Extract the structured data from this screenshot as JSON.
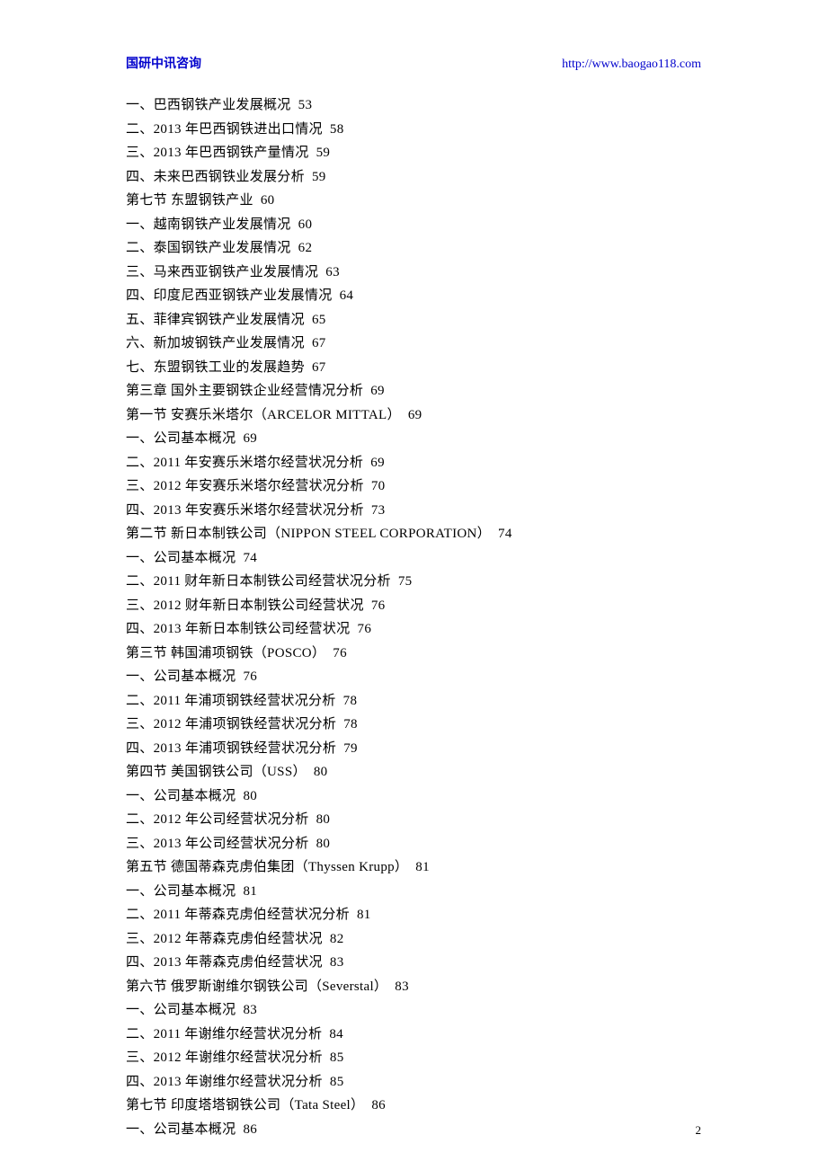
{
  "header": {
    "left": "国研中讯咨询",
    "right": "http://www.baogao118.com"
  },
  "toc": [
    {
      "label": "一、巴西钢铁产业发展概况",
      "page": "53"
    },
    {
      "label": "二、2013 年巴西钢铁进出口情况",
      "page": "58"
    },
    {
      "label": "三、2013 年巴西钢铁产量情况",
      "page": "59"
    },
    {
      "label": "四、未来巴西钢铁业发展分析",
      "page": "59"
    },
    {
      "label": "第七节  东盟钢铁产业",
      "page": "60"
    },
    {
      "label": "一、越南钢铁产业发展情况",
      "page": "60"
    },
    {
      "label": "二、泰国钢铁产业发展情况",
      "page": "62"
    },
    {
      "label": "三、马来西亚钢铁产业发展情况",
      "page": "63"
    },
    {
      "label": "四、印度尼西亚钢铁产业发展情况",
      "page": "64"
    },
    {
      "label": "五、菲律宾钢铁产业发展情况",
      "page": "65"
    },
    {
      "label": "六、新加坡钢铁产业发展情况",
      "page": "67"
    },
    {
      "label": "七、东盟钢铁工业的发展趋势",
      "page": "67"
    },
    {
      "label": "第三章  国外主要钢铁企业经营情况分析",
      "page": "69"
    },
    {
      "label": "第一节  安赛乐米塔尔（ARCELOR MITTAL）",
      "page": "69"
    },
    {
      "label": "一、公司基本概况",
      "page": "69"
    },
    {
      "label": "二、2011 年安赛乐米塔尔经营状况分析",
      "page": "69"
    },
    {
      "label": "三、2012 年安赛乐米塔尔经营状况分析",
      "page": "70"
    },
    {
      "label": "四、2013 年安赛乐米塔尔经营状况分析",
      "page": "73"
    },
    {
      "label": "第二节  新日本制铁公司（NIPPON STEEL CORPORATION）",
      "page": "74"
    },
    {
      "label": "一、公司基本概况",
      "page": "74"
    },
    {
      "label": "二、2011 财年新日本制铁公司经营状况分析",
      "page": "75"
    },
    {
      "label": "三、2012 财年新日本制铁公司经营状况",
      "page": "76"
    },
    {
      "label": "四、2013 年新日本制铁公司经营状况",
      "page": "76"
    },
    {
      "label": "第三节  韩国浦项钢铁（POSCO）",
      "page": "76"
    },
    {
      "label": "一、公司基本概况",
      "page": "76"
    },
    {
      "label": "二、2011 年浦项钢铁经营状况分析",
      "page": "78"
    },
    {
      "label": "三、2012 年浦项钢铁经营状况分析",
      "page": "78"
    },
    {
      "label": "四、2013 年浦项钢铁经营状况分析",
      "page": "79"
    },
    {
      "label": "第四节  美国钢铁公司（USS）",
      "page": "80"
    },
    {
      "label": "一、公司基本概况",
      "page": "80"
    },
    {
      "label": "二、2012 年公司经营状况分析",
      "page": "80"
    },
    {
      "label": "三、2013 年公司经营状况分析",
      "page": "80"
    },
    {
      "label": "第五节  德国蒂森克虏伯集团（Thyssen Krupp）",
      "page": "81"
    },
    {
      "label": "一、公司基本概况",
      "page": "81"
    },
    {
      "label": "二、2011 年蒂森克虏伯经营状况分析",
      "page": "81"
    },
    {
      "label": "三、2012 年蒂森克虏伯经营状况",
      "page": "82"
    },
    {
      "label": "四、2013 年蒂森克虏伯经营状况",
      "page": "83"
    },
    {
      "label": "第六节  俄罗斯谢维尔钢铁公司（Severstal）",
      "page": "83"
    },
    {
      "label": "一、公司基本概况",
      "page": "83"
    },
    {
      "label": "二、2011 年谢维尔经营状况分析",
      "page": "84"
    },
    {
      "label": "三、2012 年谢维尔经营状况分析",
      "page": "85"
    },
    {
      "label": "四、2013 年谢维尔经营状况分析",
      "page": "85"
    },
    {
      "label": "第七节  印度塔塔钢铁公司（Tata Steel）",
      "page": "86"
    },
    {
      "label": "一、公司基本概况",
      "page": "86"
    }
  ],
  "page_number": "2"
}
